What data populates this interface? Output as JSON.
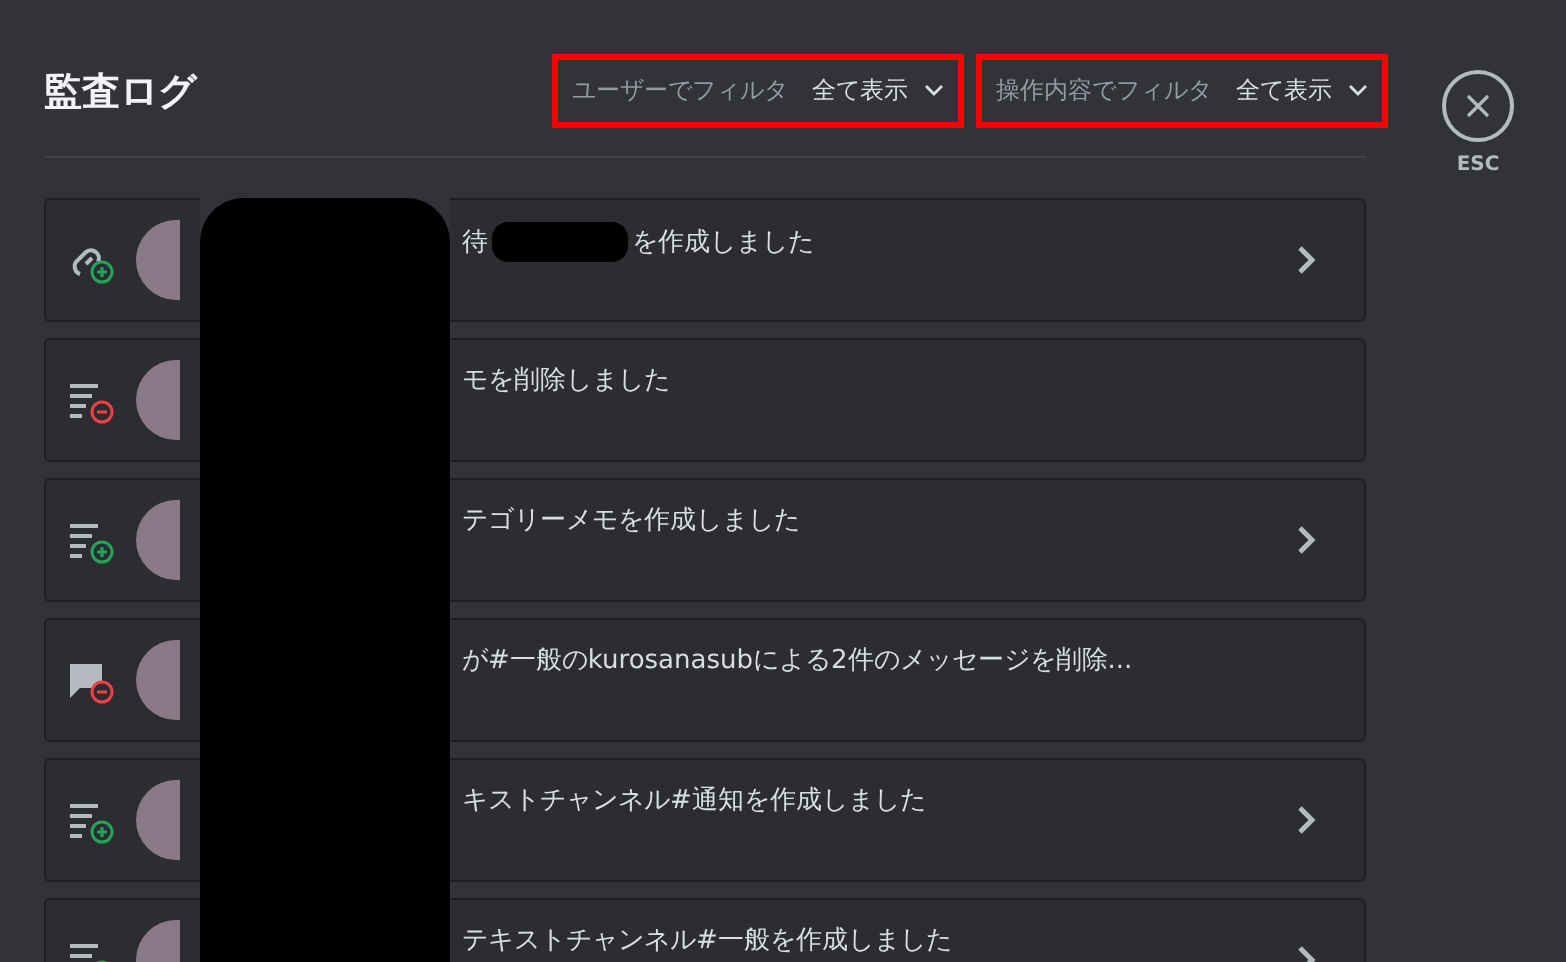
{
  "header": {
    "title": "監査ログ",
    "close_label": "ESC"
  },
  "filters": [
    {
      "label": "ユーザーでフィルタ",
      "value": "全て表示",
      "highlighted": true
    },
    {
      "label": "操作内容でフィルタ",
      "value": "全て表示",
      "highlighted": true
    }
  ],
  "entries": [
    {
      "kind": "invite-create",
      "segments": [
        "待",
        "を作成しました"
      ],
      "expandable": true
    },
    {
      "kind": "memo-delete",
      "segments": [
        "モを削除しました"
      ],
      "expandable": false
    },
    {
      "kind": "memo-create",
      "segments": [
        "テゴリーメモを作成しました"
      ],
      "expandable": true
    },
    {
      "kind": "message-delete",
      "segments": [
        "が#一般のkurosanasubによる2件のメッセージを削除..."
      ],
      "expandable": false
    },
    {
      "kind": "channel-create",
      "segments": [
        "キストチャンネル#通知を作成しました"
      ],
      "expandable": true
    },
    {
      "kind": "channel-create",
      "segments": [
        "テキストチャンネル#一般を作成しました"
      ],
      "expandable": true
    }
  ]
}
